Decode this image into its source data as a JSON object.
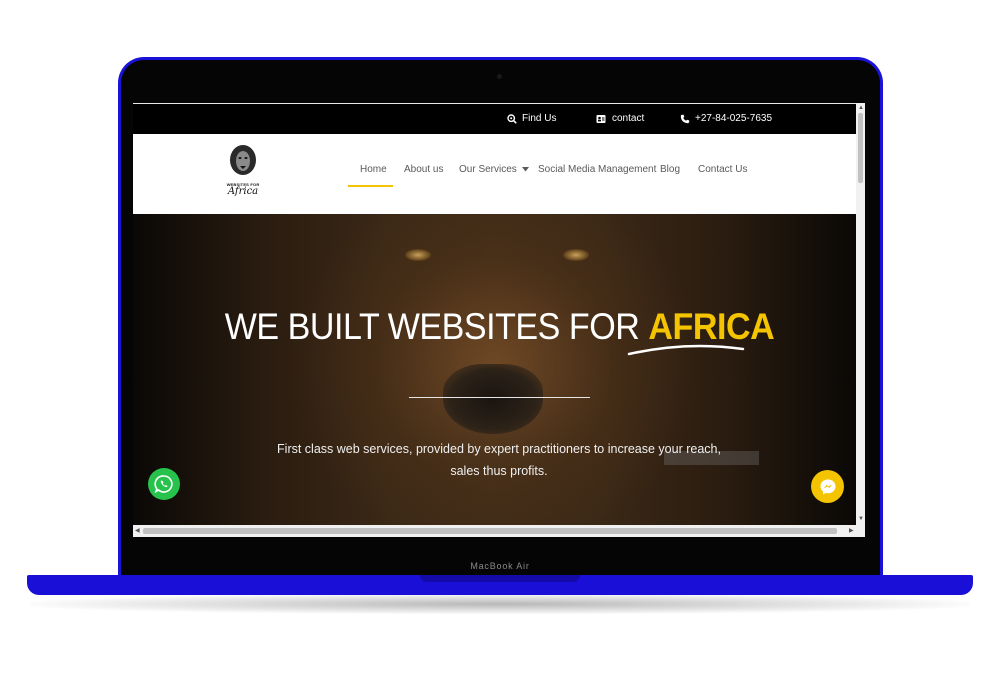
{
  "device": {
    "label": "MacBook Air"
  },
  "topbar": {
    "find_us": "Find Us",
    "contact": "contact",
    "phone": "+27-84-025-7635"
  },
  "logo": {
    "line1": "WEBSITES FOR",
    "line2": "Africa"
  },
  "nav": {
    "items": [
      {
        "label": "Home",
        "active": true
      },
      {
        "label": "About us"
      },
      {
        "label": "Our Services",
        "has_dropdown": true
      },
      {
        "label": "Social Media Management"
      },
      {
        "label": "Blog"
      },
      {
        "label": "Contact Us"
      }
    ]
  },
  "hero": {
    "title_main": "WE BUILT WEBSITES FOR ",
    "title_accent": "AFRICA",
    "subtitle": "First class web services, provided by expert practitioners to increase your reach, sales thus profits."
  },
  "colors": {
    "frame": "#1b12d8",
    "accent": "#f5c400",
    "whatsapp": "#27c24c"
  },
  "icons": {
    "find_us": "search-location-icon",
    "contact": "address-card-icon",
    "phone": "phone-icon",
    "dropdown": "caret-down-icon",
    "whatsapp": "whatsapp-icon",
    "messenger": "messenger-icon"
  }
}
